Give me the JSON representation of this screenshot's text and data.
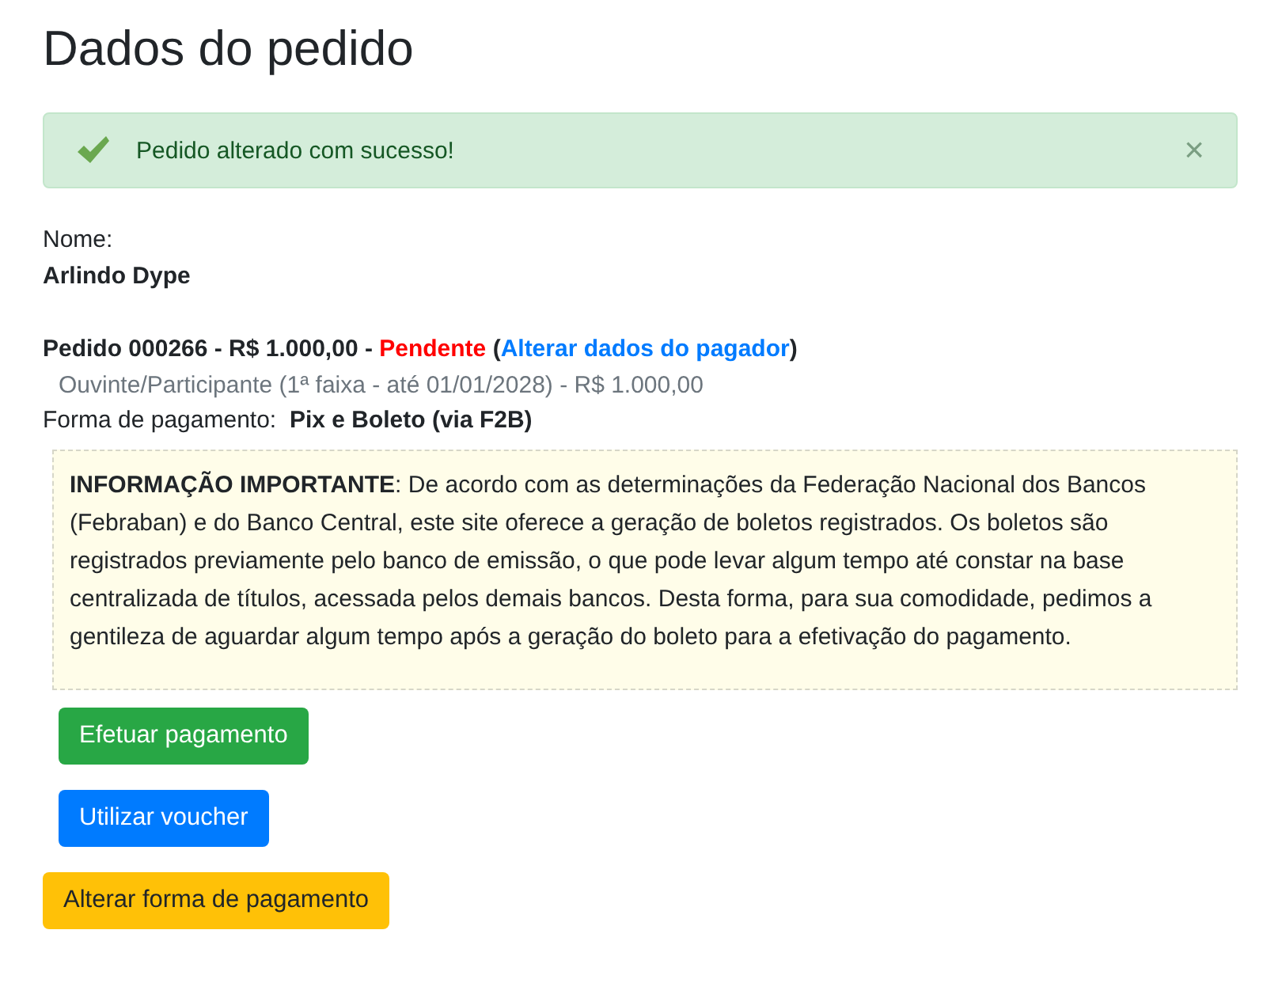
{
  "title": "Dados do pedido",
  "alert": {
    "message": "Pedido alterado com sucesso!",
    "close": "×"
  },
  "name_label": "Nome:",
  "name_value": "Arlindo Dype",
  "order": {
    "text": "Pedido 000266 - R$ 1.000,00 -",
    "status": "Pendente",
    "open": "(",
    "link": "Alterar dados do pagador",
    "close": ")"
  },
  "item_line": "Ouvinte/Participante (1ª faixa - até 01/01/2028) - R$ 1.000,00",
  "payment_label": "Forma de pagamento:",
  "payment_value": "Pix e Boleto (via F2B)",
  "notice": "**INFORMAÇÃO IMPORTANTE**: De acordo com as determinações da Federação Nacional dos Bancos (Febraban) e do Banco Central, este site oferece a geração de boletos registrados. Os boletos são registrados previamente pelo banco de emissão, o que pode levar algum tempo até constar na base centralizada de títulos, acessada pelos demais bancos. Desta forma, para sua comodidade, pedimos a gentileza de aguardar algum tempo após a geração do boleto para a efetivação do pagamento.",
  "buttons": [
    {
      "label": "Efetuar pagamento",
      "kind": "success"
    },
    {
      "label": "Utilizar voucher",
      "kind": "primary"
    },
    {
      "label": "Alterar forma de pagamento",
      "kind": "warning"
    }
  ]
}
